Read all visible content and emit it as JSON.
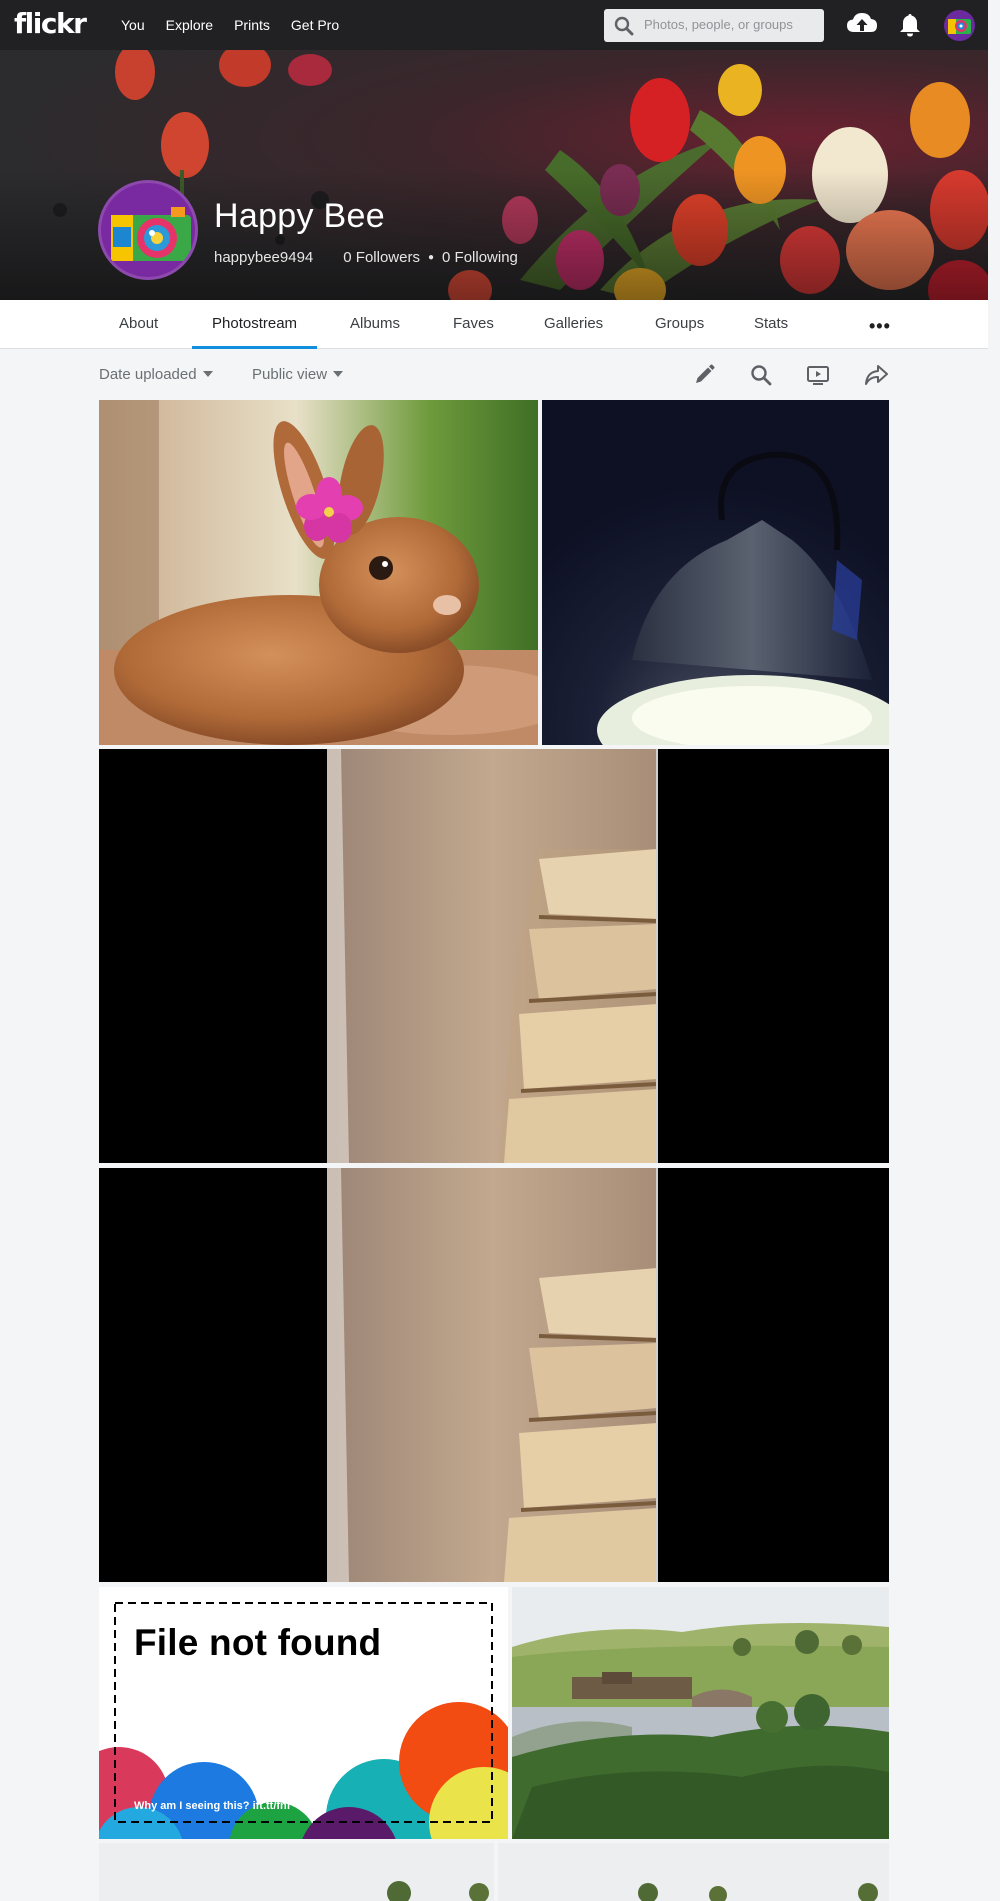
{
  "nav": {
    "logo": "flickr",
    "links": [
      "You",
      "Explore",
      "Prints",
      "Get Pro"
    ],
    "search_placeholder": "Photos, people, or groups",
    "icons": [
      "upload-icon",
      "bell-icon",
      "avatar"
    ]
  },
  "profile": {
    "display_name": "Happy Bee",
    "username": "happybee9494",
    "followers": "0 Followers",
    "following": "0 Following"
  },
  "tabs": {
    "about": "About",
    "photostream": "Photostream",
    "albums": "Albums",
    "faves": "Faves",
    "galleries": "Galleries",
    "groups": "Groups",
    "stats": "Stats",
    "active": "Photostream"
  },
  "toolbar": {
    "sort": "Date uploaded",
    "view": "Public view",
    "icons": [
      "edit-icon",
      "search-icon",
      "slideshow-icon",
      "share-icon"
    ]
  },
  "photos": {
    "file_not_found": {
      "title": "File not found",
      "help": "Why am I seeing this? ift.tt/fnf"
    }
  },
  "colors": {
    "nav_bg": "#212124",
    "accent": "#128fdc",
    "page_bg": "#f3f5f6"
  }
}
